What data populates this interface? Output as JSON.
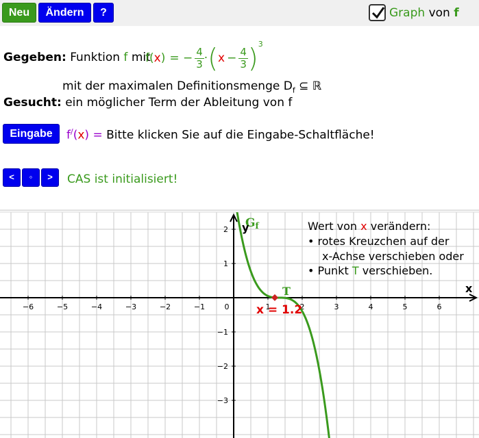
{
  "toolbar": {
    "neu": "Neu",
    "aendern": "Ändern",
    "help": "?",
    "graph_label_prefix": "Graph",
    "graph_label_mid": "von",
    "graph_label_f": "f",
    "graph_checked": true
  },
  "task": {
    "gegeben_label": "Gegeben:",
    "gegeben_text1": "Funktion",
    "f": "f",
    "gegeben_text2": "mit",
    "f_lhs_f": "f",
    "paren_open": "(",
    "x": "x",
    "paren_close": ")",
    "eq_minus": "= −",
    "frac_num": "4",
    "frac_den": "3",
    "dot": "·",
    "inner_x": "x",
    "inner_minus": "−",
    "inner_frac_num": "4",
    "inner_frac_den": "3",
    "exponent": "3",
    "domain_text": "mit der maximalen Definitionsmenge D",
    "domain_sub": "f",
    "domain_rest": "⊆ ℝ",
    "gesucht_label": "Gesucht:",
    "gesucht_text": "ein möglicher Term der Ableitung von f"
  },
  "input": {
    "eingabe_button": "Eingabe",
    "fprime": "f",
    "prime": "/",
    "open": "(",
    "x": "x",
    "close": ")",
    "eq": "=",
    "message": "Bitte klicken Sie auf die Eingabe-Schaltfläche!"
  },
  "nav": {
    "prev": "<",
    "mid": "◦",
    "next": ">",
    "status": "CAS ist initialisiert!"
  },
  "plot": {
    "x_axis_label": "x",
    "y_axis_label": "y",
    "graph_name": "G",
    "graph_name_sub": "f",
    "point_label": "T",
    "slider_label": "x = 1.2",
    "x_ticks": [
      "−6",
      "−5",
      "−4",
      "−3",
      "−2",
      "−1",
      "0",
      "1",
      "2",
      "3",
      "4",
      "5",
      "6"
    ],
    "y_ticks": [
      "2",
      "1",
      "−1",
      "−2",
      "−3"
    ],
    "hint_line1_a": "Wert von",
    "hint_line1_x": "x",
    "hint_line1_b": "verändern:",
    "hint_line2": "• rotes Kreuzchen auf der",
    "hint_line3": "x-Achse verschieben oder",
    "hint_line4_a": "• Punkt",
    "hint_line4_T": "T",
    "hint_line4_b": "verschieben.",
    "colors": {
      "curve": "#3a9a1d",
      "point": "#cc2222",
      "grid": "#c8c8c8"
    }
  },
  "chart_data": {
    "type": "line",
    "function": "f(x) = -4/3 * (x - 4/3)^3",
    "xlim": [
      -7,
      7
    ],
    "ylim": [
      -4,
      2.3
    ],
    "grid": true,
    "series": [
      {
        "name": "G_f",
        "points_x": [
          0.2,
          0.5,
          0.8,
          1.0,
          1.2,
          1.33,
          1.6,
          1.9,
          2.2,
          2.5,
          2.8
        ]
      }
    ],
    "marked_point": {
      "name": "T",
      "x": 1.2
    }
  }
}
